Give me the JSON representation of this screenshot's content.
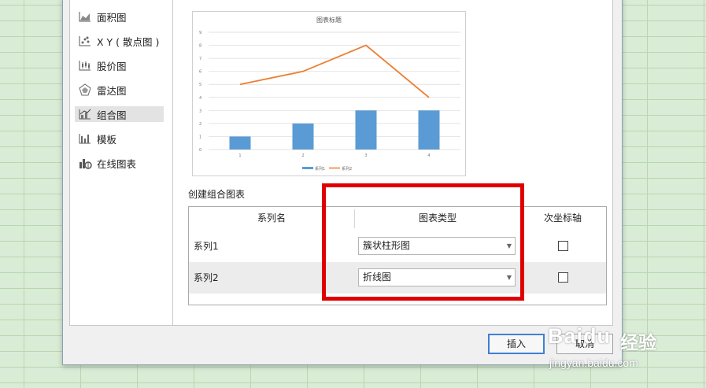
{
  "sidebar": {
    "items": [
      {
        "label": "面积图",
        "icon": "area-chart-icon"
      },
      {
        "label": "X Y ( 散点图 )",
        "icon": "scatter-chart-icon"
      },
      {
        "label": "股价图",
        "icon": "stock-chart-icon"
      },
      {
        "label": "雷达图",
        "icon": "radar-chart-icon"
      },
      {
        "label": "组合图",
        "icon": "combo-chart-icon",
        "selected": true
      },
      {
        "label": "模板",
        "icon": "template-icon"
      },
      {
        "label": "在线图表",
        "icon": "online-chart-icon"
      }
    ]
  },
  "preview": {
    "chart_data": {
      "type": "bar",
      "title": "图表标题",
      "categories": [
        "1",
        "2",
        "3",
        "4"
      ],
      "ylim": [
        0,
        9
      ],
      "yticks": [
        "0",
        "1",
        "2",
        "3",
        "4",
        "5",
        "6",
        "7",
        "8",
        "9"
      ],
      "grid": true,
      "legend_position": "bottom",
      "series": [
        {
          "name": "系列1",
          "type": "bar",
          "values": [
            1,
            2,
            3,
            3
          ],
          "color": "#5b9bd5"
        },
        {
          "name": "系列2",
          "type": "line",
          "values": [
            5,
            6,
            8,
            4
          ],
          "color": "#ed7d31"
        }
      ]
    }
  },
  "combo_section": {
    "title": "创建组合图表",
    "headers": {
      "series_name": "系列名",
      "chart_type": "图表类型",
      "secondary_axis": "次坐标轴"
    },
    "rows": [
      {
        "name": "系列1",
        "chart_type": "簇状柱形图",
        "secondary_axis": false
      },
      {
        "name": "系列2",
        "chart_type": "折线图",
        "secondary_axis": false
      }
    ]
  },
  "buttons": {
    "insert": "插入",
    "cancel": "取消"
  },
  "highlight_color": "#e00000",
  "watermark": {
    "logo": "Baidu",
    "cn": "经验",
    "url": "jingyan.baidu.com"
  }
}
